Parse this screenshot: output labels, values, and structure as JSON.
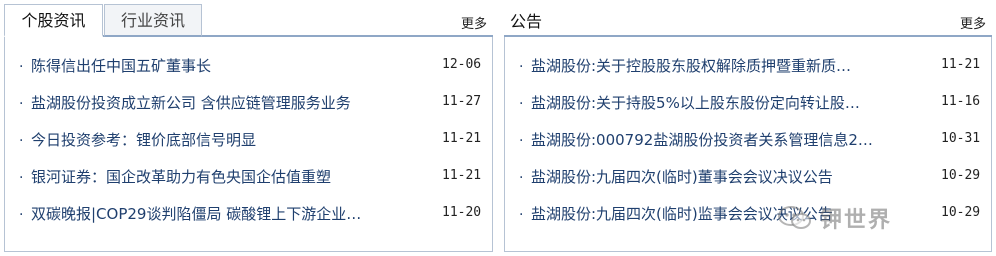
{
  "left_panel": {
    "tabs": [
      {
        "label": "个股资讯",
        "active": true
      },
      {
        "label": "行业资讯",
        "active": false
      }
    ],
    "more_label": "更多",
    "items": [
      {
        "title": "陈得信出任中国五矿董事长",
        "date": "12-06"
      },
      {
        "title": "盐湖股份投资成立新公司 含供应链管理服务业务",
        "date": "11-27"
      },
      {
        "title": "今日投资参考：锂价底部信号明显",
        "date": "11-21"
      },
      {
        "title": "银河证券：国企改革助力有色央国企估值重塑",
        "date": "11-21"
      },
      {
        "title": "双碳晚报|COP29谈判陷僵局 碳酸锂上下游企业…",
        "date": "11-20"
      }
    ]
  },
  "right_panel": {
    "title": "公告",
    "more_label": "更多",
    "items": [
      {
        "title": "盐湖股份:关于控股股东股权解除质押暨重新质…",
        "date": "11-21"
      },
      {
        "title": "盐湖股份:关于持股5%以上股东股份定向转让股…",
        "date": "11-16"
      },
      {
        "title": "盐湖股份:000792盐湖股份投资者关系管理信息2…",
        "date": "10-31"
      },
      {
        "title": "盐湖股份:九届四次(临时)董事会会议决议公告",
        "date": "10-29"
      },
      {
        "title": "盐湖股份:九届四次(临时)监事会会议决议公告",
        "date": "10-29"
      }
    ]
  },
  "watermark": {
    "text": "钾世界",
    "icon": "wechat-icon"
  },
  "colors": {
    "link": "#1f3f6e",
    "border": "#8fa7c6",
    "panel_border": "#b6c3d4"
  }
}
